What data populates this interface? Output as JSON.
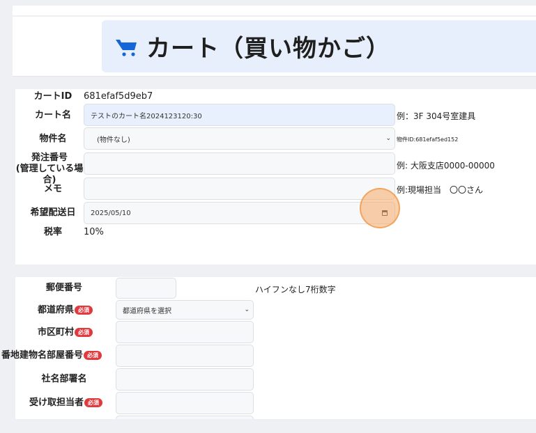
{
  "header": {
    "icon": "cart-icon",
    "title": "カート（買い物かご）"
  },
  "cart_form": {
    "cart_id": {
      "label": "カートID",
      "value": "681efaf5d9eb7"
    },
    "cart_name": {
      "label": "カート名",
      "value": "テストのカート名2024123120:30",
      "hint": "例：3F 304号室建具"
    },
    "property": {
      "label": "物件名",
      "value": "(物件なし)",
      "hint": "物件ID:681efaf5ed152"
    },
    "order_number": {
      "label_line1": "発注番号",
      "label_line2": "(管理している場合)",
      "value": "",
      "hint": "例: 大阪支店0000-00000"
    },
    "memo": {
      "label": "メモ",
      "value": "",
      "hint": "例:現場担当　〇〇さん"
    },
    "delivery_date": {
      "label": "希望配送日",
      "value": "2025/05/10",
      "icon": "calendar-icon"
    },
    "tax_rate": {
      "label": "税率",
      "value": "10%"
    }
  },
  "address_form": {
    "required_badge": "必須",
    "postal_code": {
      "label": "郵便番号",
      "value": "",
      "hint": "ハイフンなし7桁数字"
    },
    "prefecture": {
      "label": "都道府県",
      "value": "都道府県を選択"
    },
    "city": {
      "label": "市区町村",
      "value": ""
    },
    "street": {
      "label": "番地建物名部屋番号",
      "value": ""
    },
    "company_dept": {
      "label": "社名部署名",
      "value": ""
    },
    "recipient": {
      "label": "受け取担当者",
      "value": ""
    }
  },
  "colors": {
    "title_bg": "#e6effb",
    "accent_blue": "#1565d8",
    "required_red": "#e0393e",
    "cursor_highlight": "#f5aa64"
  }
}
